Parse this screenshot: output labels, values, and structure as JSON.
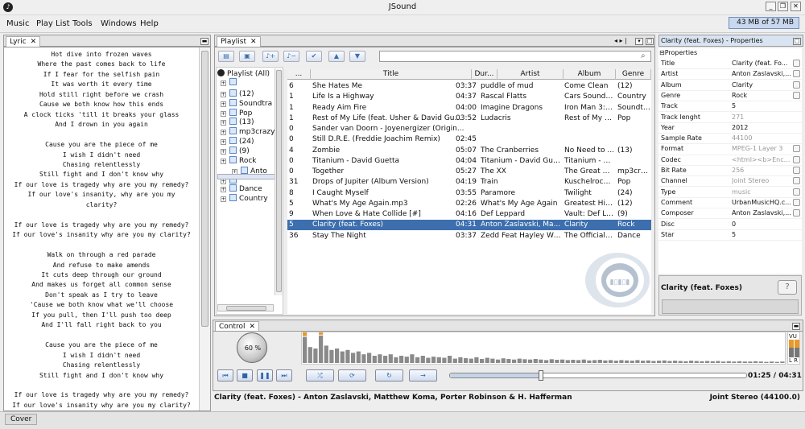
{
  "window": {
    "title": "JSound",
    "icon": "music-note-icon"
  },
  "menu": [
    "Music",
    "Play List",
    "Tools",
    "Windows",
    "Help"
  ],
  "memory": "43 MB of 57 MB",
  "lyric": {
    "tab": "Lyric",
    "lines": [
      "Hot dive into frozen waves",
      "Where the past comes back to life",
      "If I fear for the selfish pain",
      "It was worth it every time",
      "Hold still right before we crash",
      "Cause we both know how this ends",
      "A clock ticks 'till it breaks your glass",
      "And I drown in you again",
      "",
      "Cause you are the piece of me",
      "I wish I didn't need",
      "Chasing relentlessly",
      "Still fight and I don't know why",
      "If our love is tragedy why are you my remedy?",
      "If our love's insanity, why are you my",
      "clarity?",
      "",
      "If our love is tragedy why are you my remedy?",
      "If our love's insanity why are you my clarity?",
      "",
      "Walk on through a red parade",
      "And refuse to make amends",
      "It cuts deep through our ground",
      "And makes us forget all common sense",
      "Don't speak as I try to leave",
      "'Cause we both know what we'll choose",
      "If you pull, then I'll push too deep",
      "And I'll fall right back to you",
      "",
      "Cause you are the piece of me",
      "I wish I didn't need",
      "Chasing relentlessly",
      "Still fight and I don't know why",
      "",
      "If our love is tragedy why are you my remedy?",
      "If our love's insanity why are you my clarity?"
    ]
  },
  "playlist": {
    "tab": "Playlist",
    "tree": {
      "root": "Playlist (All)",
      "items": [
        "",
        "(12)",
        "Soundtra",
        "Pop",
        "(13)",
        "mp3crazy",
        "(24)",
        "(9)",
        "Rock",
        "Anto",
        "",
        "Dance",
        "Country"
      ]
    },
    "columns": [
      "...",
      "Title",
      "Dur...",
      "Artist",
      "Album",
      "Genre"
    ],
    "rows": [
      {
        "n": "6",
        "title": "She Hates Me",
        "dur": "03:37",
        "artist": "puddle of mud",
        "album": "Come Clean",
        "genre": "(12)"
      },
      {
        "n": "1",
        "title": "Life Is a Highway",
        "dur": "04:37",
        "artist": "Rascal Flatts",
        "album": "Cars Soundtr...",
        "genre": "Country"
      },
      {
        "n": "1",
        "title": "Ready Aim Fire",
        "dur": "04:00",
        "artist": "Imagine Dragons",
        "album": "Iron Man 3: ...",
        "genre": "Soundtr..."
      },
      {
        "n": "1",
        "title": "Rest of My Life (feat. Usher & David Gu...",
        "dur": "03:52",
        "artist": "Ludacris",
        "album": "Rest of My Lif...",
        "genre": "Pop"
      },
      {
        "n": "0",
        "title": "Sander van Doorn - Joyenergizer (Origin...",
        "dur": "",
        "artist": "",
        "album": "",
        "genre": ""
      },
      {
        "n": "0",
        "title": "Still D.R.E. (Freddie Joachim Remix)",
        "dur": "02:45",
        "artist": "",
        "album": "",
        "genre": ""
      },
      {
        "n": "4",
        "title": "Zombie",
        "dur": "05:07",
        "artist": "The Cranberries",
        "album": "No Need to ...",
        "genre": "(13)"
      },
      {
        "n": "0",
        "title": "Titanium - David Guetta",
        "dur": "04:04",
        "artist": "Titanium - David Guetta",
        "album": "Titanium - Da...",
        "genre": ""
      },
      {
        "n": "0",
        "title": "Together",
        "dur": "05:27",
        "artist": "The XX",
        "album": "The Great Ga...",
        "genre": "mp3crazy"
      },
      {
        "n": "31",
        "title": "Drops of Jupiter (Album Version)",
        "dur": "04:19",
        "artist": "Train",
        "album": "Kuschelrock ...",
        "genre": "Pop"
      },
      {
        "n": "8",
        "title": "I Caught Myself",
        "dur": "03:55",
        "artist": "Paramore",
        "album": "Twilight",
        "genre": "(24)"
      },
      {
        "n": "5",
        "title": "What's My Age Again.mp3",
        "dur": "02:26",
        "artist": "What's My Age Again",
        "album": "Greatest Hits...",
        "genre": "(12)"
      },
      {
        "n": "9",
        "title": "When Love & Hate Collide [#]",
        "dur": "04:16",
        "artist": "Def Leppard",
        "album": "Vault: Def Le...",
        "genre": "(9)"
      },
      {
        "n": "5",
        "title": "Clarity (feat. Foxes)",
        "dur": "04:31",
        "artist": "Anton Zaslavski, Ma...",
        "album": "Clarity",
        "genre": "Rock",
        "selected": true
      },
      {
        "n": "36",
        "title": "Stay The Night",
        "dur": "03:37",
        "artist": "Zedd Feat Hayley Willa...",
        "album": "The Official U...",
        "genre": "Dance"
      }
    ]
  },
  "properties": {
    "tab": "Clarity (feat. Foxes) - Properties",
    "section": "Properties",
    "rows": [
      {
        "key": "Title",
        "value": "Clarity (feat. Fo...",
        "btn": true
      },
      {
        "key": "Artist",
        "value": "Anton Zaslavski,...",
        "btn": true
      },
      {
        "key": "Album",
        "value": "Clarity",
        "btn": true
      },
      {
        "key": "Genre",
        "value": "Rock",
        "btn": true
      },
      {
        "key": "Track",
        "value": "5",
        "btn": false
      },
      {
        "key": "Track lenght",
        "value": "271",
        "btn": false,
        "dim": true
      },
      {
        "key": "Year",
        "value": "2012",
        "btn": false
      },
      {
        "key": "Sample Rate",
        "value": "44100",
        "btn": false,
        "dim": true
      },
      {
        "key": "Format",
        "value": "MPEG-1 Layer 3",
        "btn": true,
        "dim": true
      },
      {
        "key": "Codec",
        "value": "<html><b>Enc...",
        "btn": true,
        "dim": true
      },
      {
        "key": "Bit Rate",
        "value": "256",
        "btn": true,
        "dim": true
      },
      {
        "key": "Channel",
        "value": "Joint Stereo",
        "btn": true,
        "dim": true
      },
      {
        "key": "Type",
        "value": "music",
        "btn": true,
        "dim": true
      },
      {
        "key": "Comment",
        "value": "UrbanMusicHQ.c...",
        "btn": true
      },
      {
        "key": "Composer",
        "value": "Anton Zaslavski,...",
        "btn": true
      },
      {
        "key": "Disc",
        "value": "0",
        "btn": false
      },
      {
        "key": "Star",
        "value": "5",
        "btn": false
      }
    ],
    "footer_title": "Clarity (feat. Foxes)"
  },
  "control": {
    "tab": "Control",
    "volume": "60 %",
    "vu_label": "VU",
    "lr_label": "L R",
    "time": "01:25 / 04:31",
    "progress": 0.31,
    "now_playing": "Clarity (feat. Foxes) - Anton Zaslavski, Matthew Koma, Porter Robinson & H. Hafferman",
    "format": "Joint Stereo (44100.0)",
    "spectrum": [
      0.9,
      0.55,
      0.5,
      0.95,
      0.6,
      0.45,
      0.5,
      0.4,
      0.45,
      0.35,
      0.4,
      0.3,
      0.35,
      0.25,
      0.3,
      0.25,
      0.3,
      0.2,
      0.25,
      0.22,
      0.3,
      0.2,
      0.25,
      0.18,
      0.22,
      0.2,
      0.18,
      0.25,
      0.15,
      0.2,
      0.17,
      0.15,
      0.2,
      0.14,
      0.18,
      0.15,
      0.12,
      0.16,
      0.14,
      0.12,
      0.15,
      0.13,
      0.12,
      0.14,
      0.12,
      0.1,
      0.13,
      0.11,
      0.12,
      0.1,
      0.11,
      0.1,
      0.12,
      0.09,
      0.1,
      0.11,
      0.09,
      0.1,
      0.08,
      0.1,
      0.09,
      0.08,
      0.1,
      0.08,
      0.09,
      0.07,
      0.08,
      0.09,
      0.07,
      0.08,
      0.07,
      0.06,
      0.08,
      0.07,
      0.06,
      0.07,
      0.06,
      0.07,
      0.05,
      0.06,
      0.05,
      0.06,
      0.05,
      0.05,
      0.06,
      0.05,
      0.04,
      0.05,
      0.04,
      0.05
    ],
    "peaks": [
      1,
      0,
      0,
      1,
      0,
      0,
      0,
      0,
      0,
      0,
      0,
      0,
      0,
      0,
      0,
      0,
      0,
      0,
      0,
      0,
      0,
      0,
      0,
      0,
      0,
      0,
      0,
      0,
      0,
      0,
      0,
      0,
      0,
      0,
      0,
      0,
      0,
      0,
      0,
      0,
      0,
      0,
      0,
      0,
      0,
      0,
      0,
      0,
      0,
      0,
      0,
      0,
      0,
      0,
      0,
      0,
      0,
      0,
      0,
      0,
      0,
      0,
      0,
      0,
      0,
      0,
      0,
      0,
      0,
      0,
      0,
      0,
      0,
      0,
      0,
      0,
      0,
      0,
      0,
      0,
      0,
      0,
      0,
      0,
      0,
      0,
      0,
      0,
      0,
      0
    ]
  },
  "status": {
    "cover_tab": "Cover"
  }
}
